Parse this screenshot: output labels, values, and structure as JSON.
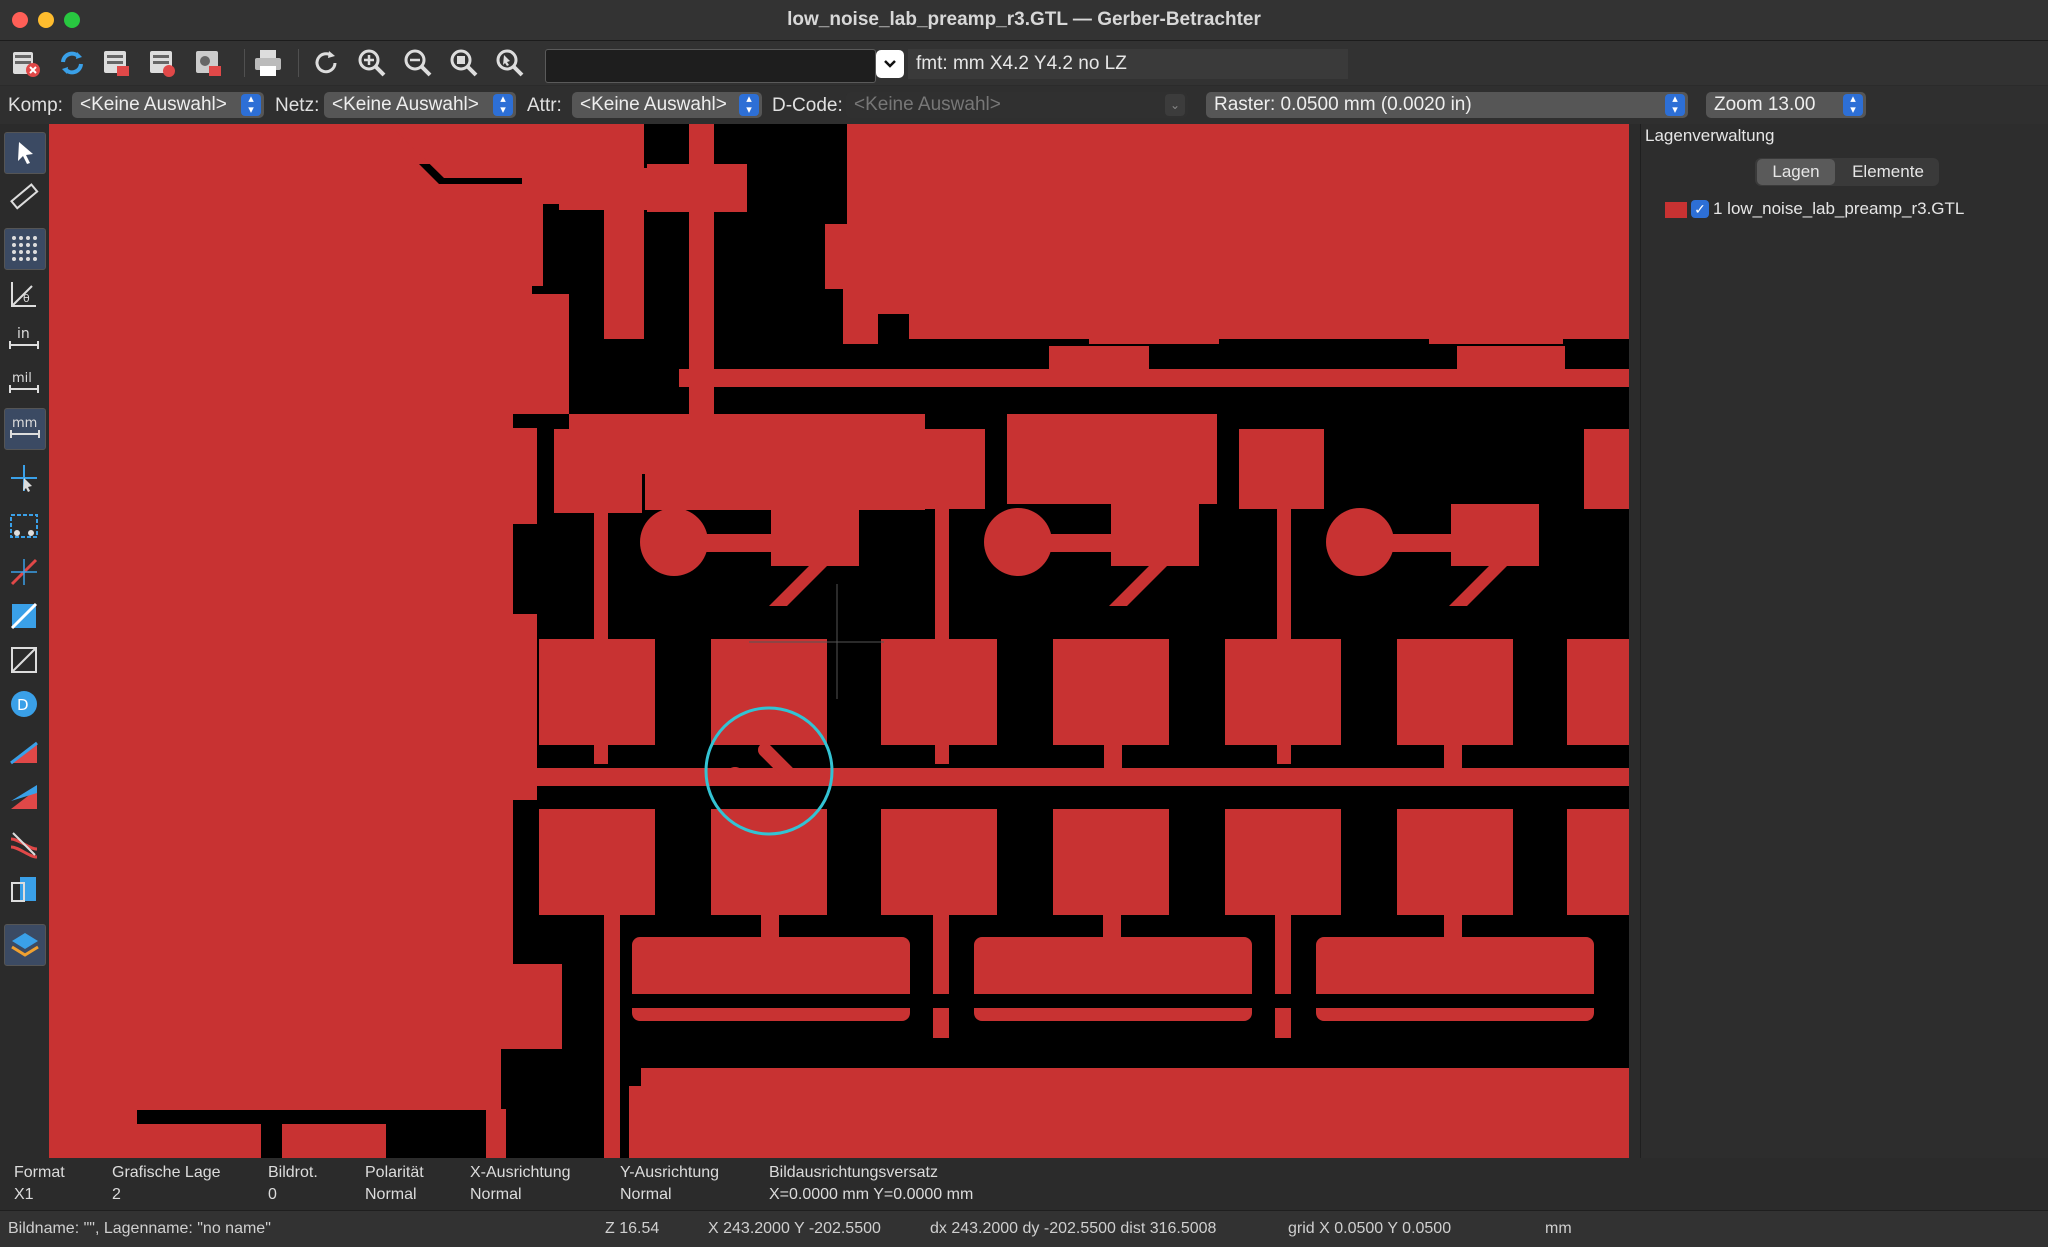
{
  "window": {
    "title": "low_noise_lab_preamp_r3.GTL — Gerber-Betrachter"
  },
  "toolbar": {
    "search_value": "",
    "format_info": "fmt: mm X4.2 Y4.2 no LZ",
    "icons": [
      "clear-layers-icon",
      "reload-icon",
      "open-gerber-icon",
      "open-drill-icon",
      "open-job-icon",
      "print-icon",
      "redraw-icon",
      "zoom-in-icon",
      "zoom-out-icon",
      "zoom-fit-icon",
      "zoom-selection-icon"
    ]
  },
  "selection": {
    "komp_label": "Komp:",
    "komp_value": "<Keine Auswahl>",
    "netz_label": "Netz:",
    "netz_value": "<Keine Auswahl>",
    "attr_label": "Attr:",
    "attr_value": "<Keine Auswahl>",
    "dcode_label": "D-Code:",
    "dcode_value": "<Keine Auswahl>",
    "raster_value": "Raster: 0.0500 mm (0.0020 in)",
    "zoom_value": "Zoom 13.00"
  },
  "left_tools": [
    "select-icon",
    "measure-icon",
    "grid-icon",
    "polar-coords-icon",
    "inch-units-icon",
    "mil-units-icon",
    "mm-units-icon",
    "cursor-crosshair-icon",
    "flash-sketch-icon",
    "line-sketch-icon",
    "polygon-sketch-icon",
    "outline-mode-icon",
    "dcode-display-icon",
    "negative-objects-icon",
    "diff-mode-icon",
    "transparency-icon",
    "flip-view-icon",
    "layers-manager-icon"
  ],
  "panel": {
    "title": "Lagenverwaltung",
    "tab_layers": "Lagen",
    "tab_items": "Elemente",
    "layer_name": "1 low_noise_lab_preamp_r3.GTL",
    "layer_color": "#c83232"
  },
  "info": {
    "format_h": "Format",
    "format_v": "X1",
    "lage_h": "Grafische Lage",
    "lage_v": "2",
    "rot_h": "Bildrot.",
    "rot_v": "0",
    "pol_h": "Polarität",
    "pol_v": "Normal",
    "xa_h": "X-Ausrichtung",
    "xa_v": "Normal",
    "ya_h": "Y-Ausrichtung",
    "ya_v": "Normal",
    "off_h": "Bildausrichtungsversatz",
    "off_v": "X=0.0000 mm Y=0.0000 mm"
  },
  "status": {
    "names": "Bildname: \"\",  Lagenname: \"no name\"",
    "z": "Z 16.54",
    "xy": "X 243.2000  Y -202.5500",
    "dxy": "dx 243.2000  dy -202.5500  dist 316.5008",
    "grid": "grid X 0.0500  Y 0.0500",
    "units": "mm"
  },
  "colors": {
    "copper": "#c83232",
    "background": "#000000",
    "cursor_ring": "#33c3d3",
    "accent": "#2d6fd6"
  }
}
